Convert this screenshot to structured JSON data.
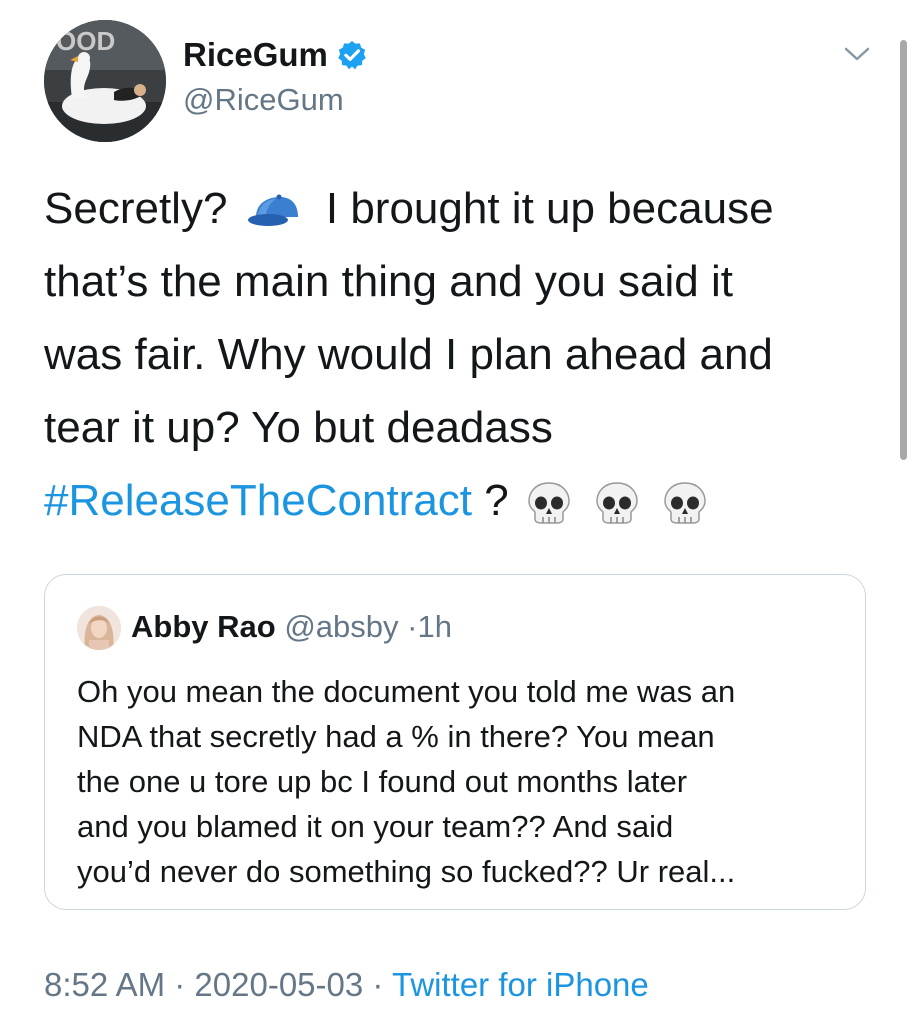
{
  "author": {
    "display_name": "RiceGum",
    "handle": "@RiceGum",
    "verified": true,
    "avatar_icon": "avatar-swan-float"
  },
  "menu": {
    "icon": "chevron-down-icon"
  },
  "tweet": {
    "lines": [
      "Secretly?",
      "I brought it up because",
      "that’s the main thing and you said it",
      "was fair. Why would I plan ahead and",
      "tear it up? Yo but deadass"
    ],
    "cap_emoji": "blue-cap-icon",
    "hashtag": "#ReleaseTheContract",
    "after_hashtag": "?",
    "skull_emoji": "skull-icon",
    "skull_count": 3
  },
  "quoted_tweet": {
    "name": "Abby Rao",
    "handle": "@absby",
    "separator": "·",
    "time": "1h",
    "lines": [
      "Oh you mean the document you told me was an",
      "NDA that secretly had a % in there? You mean",
      "the one u tore up bc I found out months later",
      "and you blamed it on your team?? And said",
      "you’d never do something so fucked?? Ur real..."
    ]
  },
  "footer": {
    "time": "8:52 AM",
    "separator": "·",
    "date": "2020-05-03",
    "source": "Twitter for iPhone"
  },
  "colors": {
    "link": "#1b95e0",
    "secondary_text": "#657786",
    "border": "#ccd6dd",
    "verified_badge": "#1da1f2"
  }
}
